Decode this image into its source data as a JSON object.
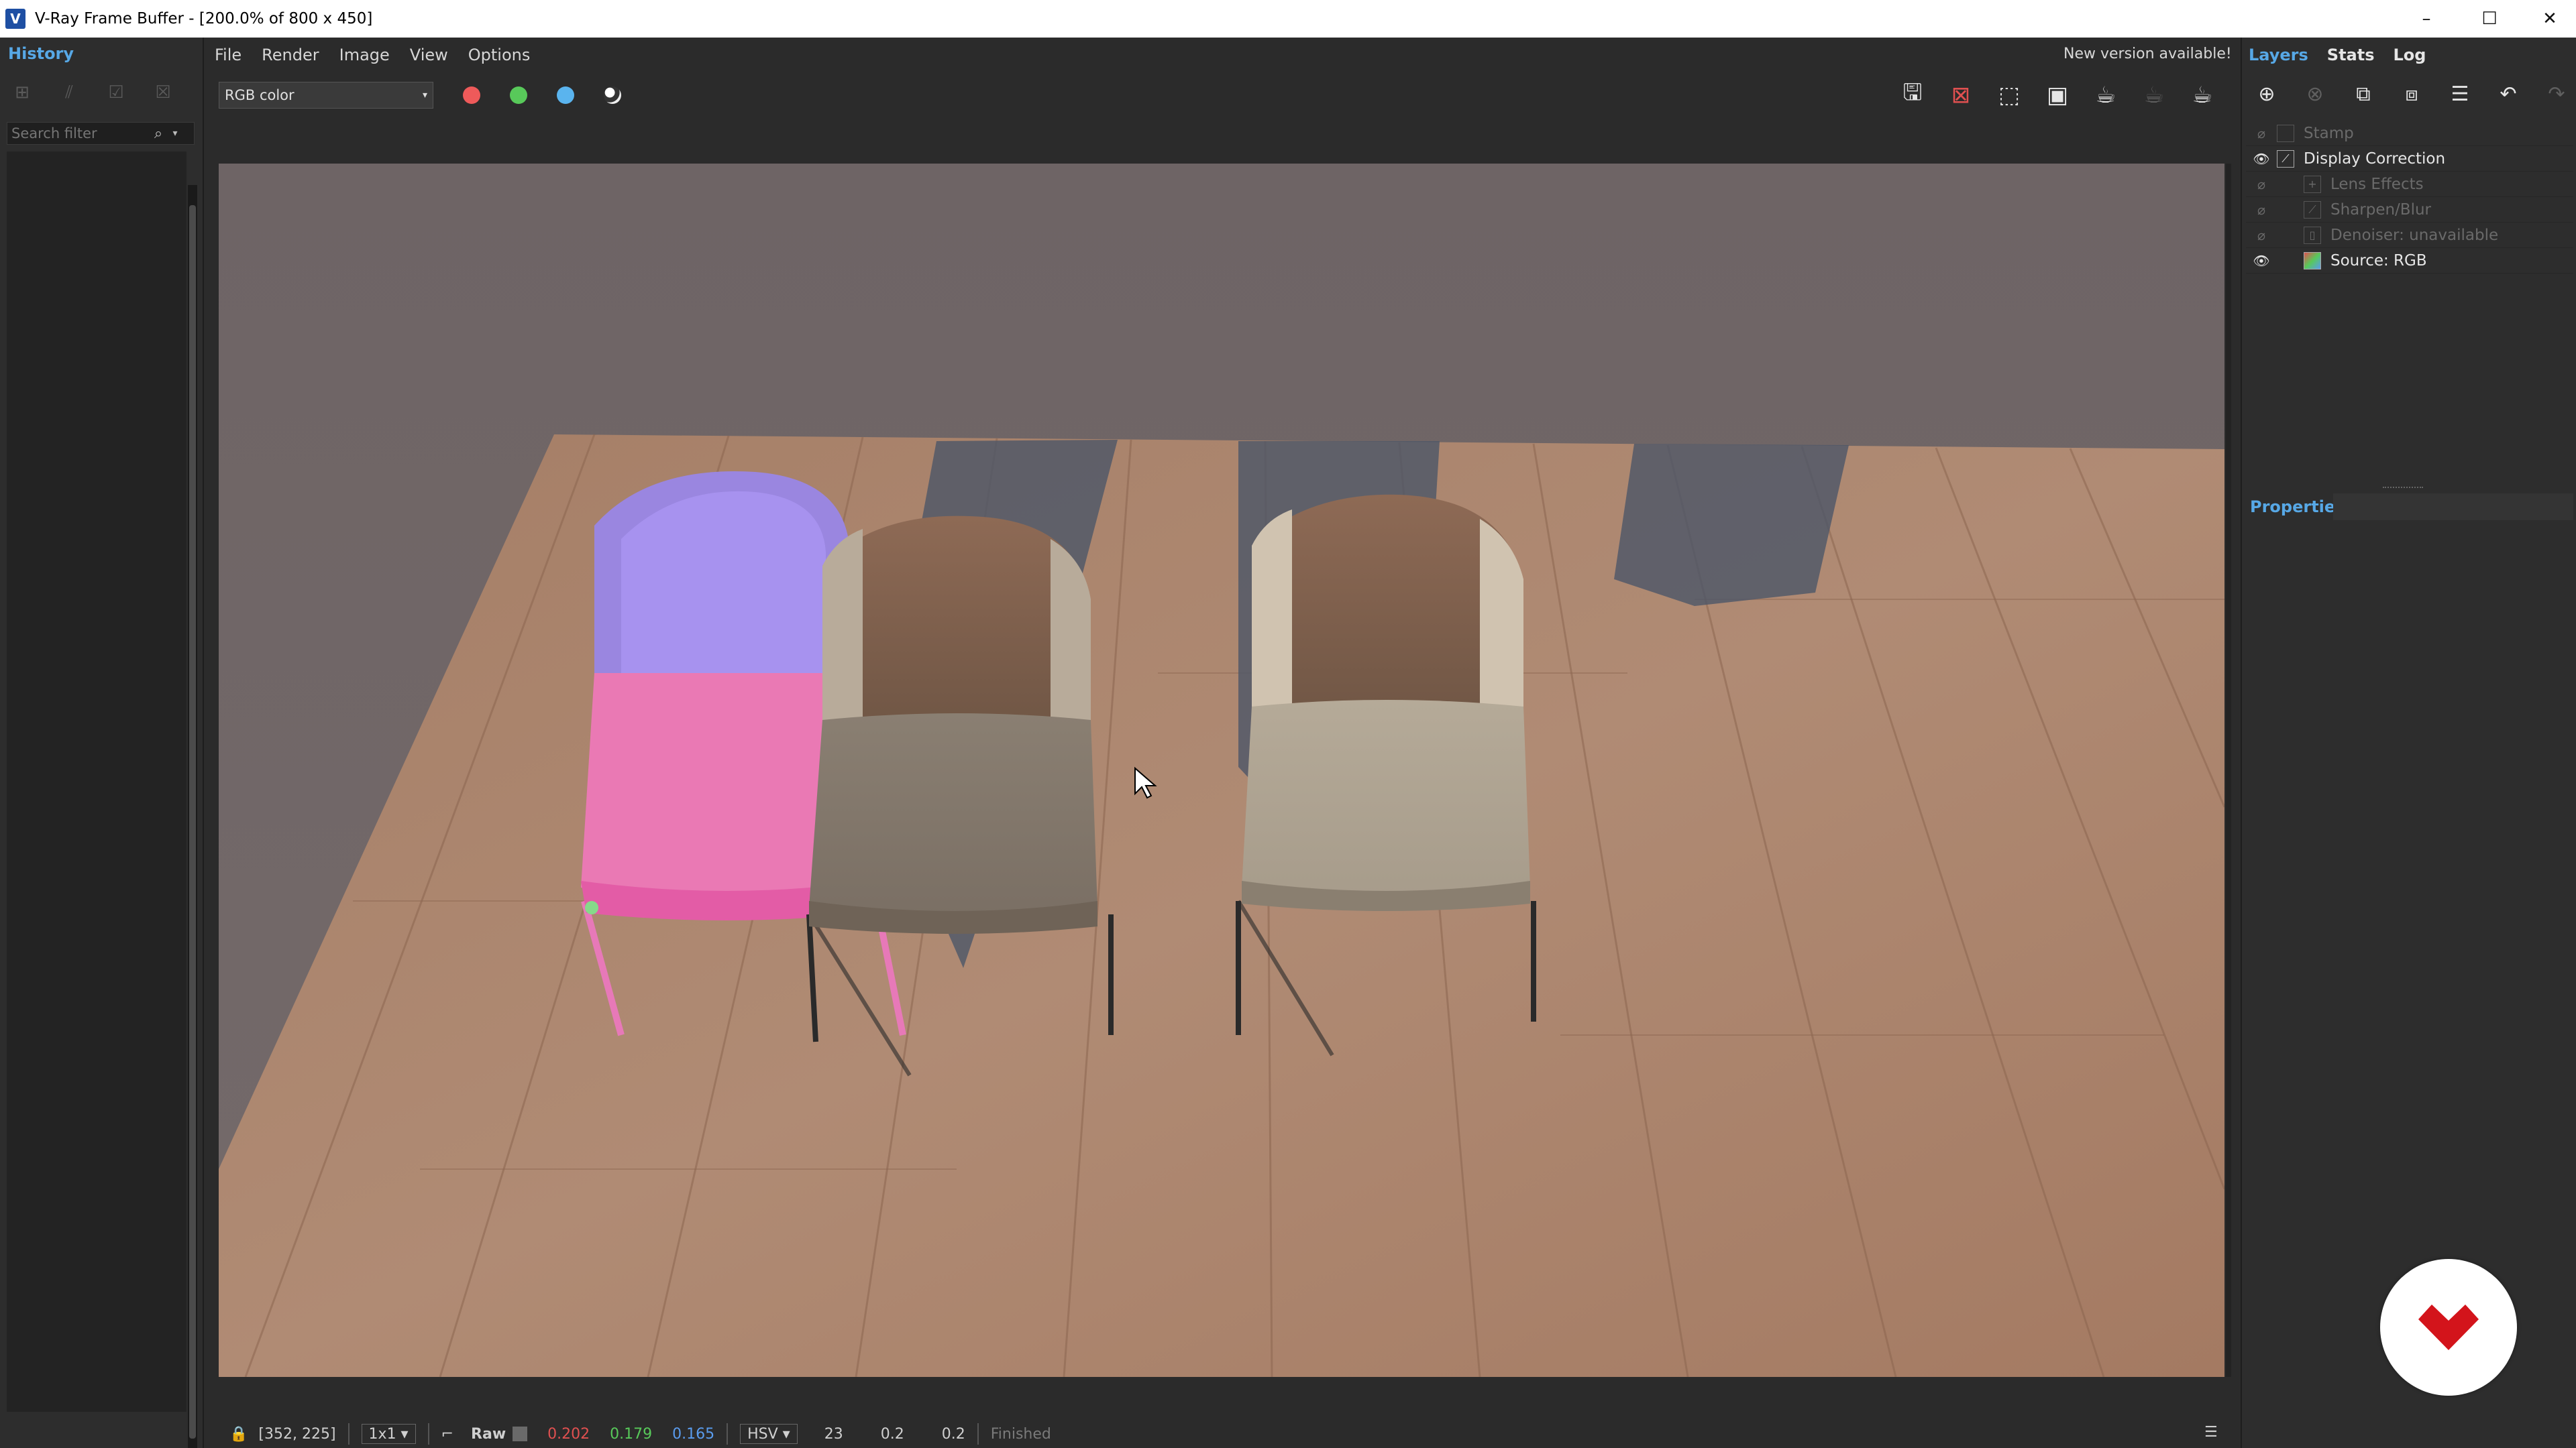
{
  "window": {
    "title": "V-Ray Frame Buffer - [200.0% of 800 x 450]",
    "app_icon_letter": "V",
    "controls": {
      "minimize": "–",
      "maximize": "☐",
      "close": "✕"
    }
  },
  "history": {
    "tab_label": "History",
    "search_placeholder": "Search filter",
    "toolbar_icons": [
      "save-to-history-icon",
      "ab-compare-icon",
      "load-history-icon",
      "remove-history-icon"
    ]
  },
  "menu": {
    "items": [
      "File",
      "Render",
      "Image",
      "View",
      "Options"
    ]
  },
  "notice": {
    "new_version": "New version available!"
  },
  "toolbar": {
    "channel": "RGB color",
    "channel_colors": {
      "red": "#ee5a5a",
      "green": "#58c95a",
      "blue": "#5ab4ee"
    }
  },
  "statusbar": {
    "coords": "[352, 225]",
    "zoom_mode": "1x1",
    "raw_label": "Raw",
    "r": "0.202",
    "g": "0.179",
    "b": "0.165",
    "color_space": "HSV",
    "h": "23",
    "s": "0.2",
    "v": "0.2",
    "state": "Finished",
    "colors": {
      "r": "#e05050",
      "g": "#58c95a",
      "b": "#5a9cee"
    }
  },
  "right_panel": {
    "tabs": [
      "Layers",
      "Stats",
      "Log"
    ],
    "layers": [
      {
        "label": "Stamp",
        "visible": false,
        "indent": 0
      },
      {
        "label": "Display Correction",
        "visible": true,
        "indent": 0
      },
      {
        "label": "Lens Effects",
        "visible": false,
        "indent": 1
      },
      {
        "label": "Sharpen/Blur",
        "visible": false,
        "indent": 1
      },
      {
        "label": "Denoiser: unavailable",
        "visible": false,
        "indent": 1
      },
      {
        "label": "Source: RGB",
        "visible": true,
        "indent": 1
      }
    ],
    "properties_label": "Properties"
  }
}
